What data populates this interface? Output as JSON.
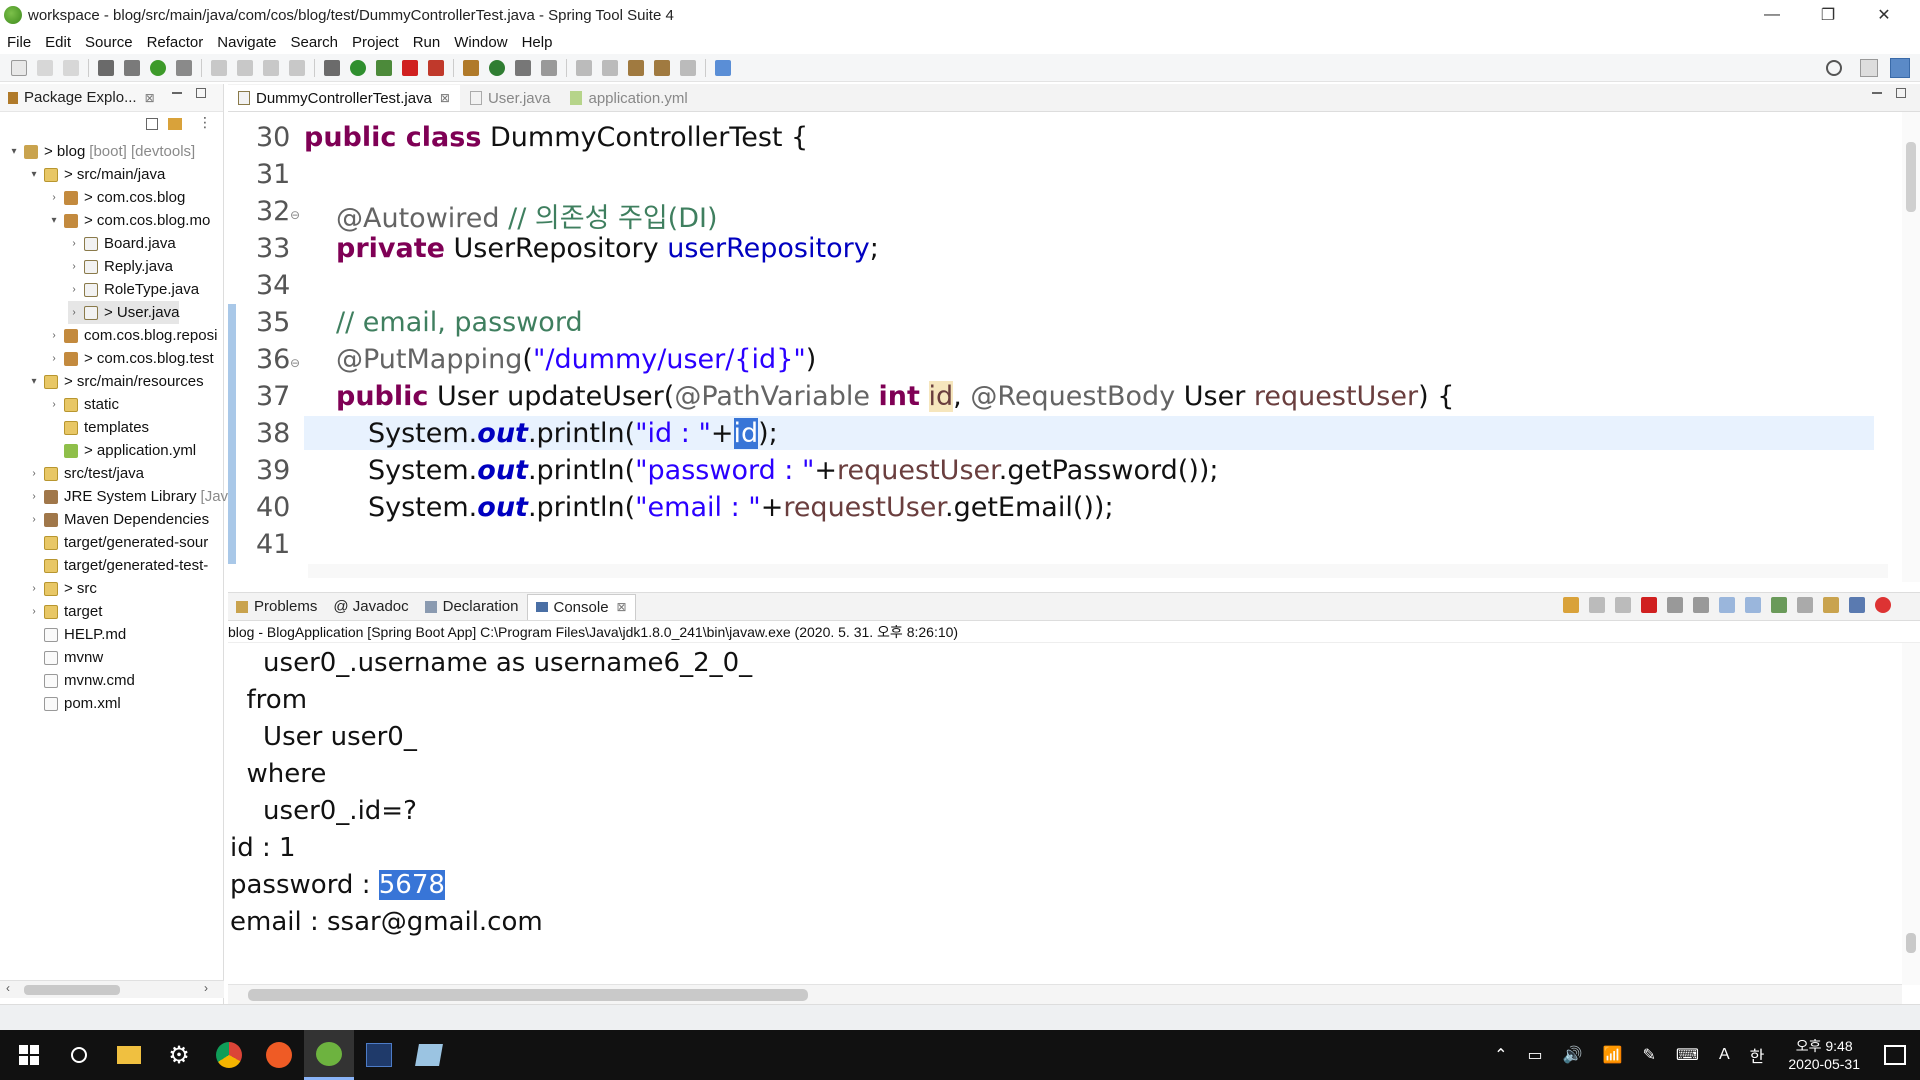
{
  "window": {
    "title": "workspace - blog/src/main/java/com/cos/blog/test/DummyControllerTest.java - Spring Tool Suite 4",
    "minimize": "—",
    "maximize": "❐",
    "close": "✕"
  },
  "menu": [
    "File",
    "Edit",
    "Source",
    "Refactor",
    "Navigate",
    "Search",
    "Project",
    "Run",
    "Window",
    "Help"
  ],
  "explorer": {
    "title": "Package Explo...",
    "close": "⊠",
    "items": [
      {
        "arrow": "▾",
        "icon": "project",
        "label": "> blog",
        "extra": "[boot] [devtools]"
      },
      {
        "arrow": "▾",
        "icon": "folder",
        "label": "> src/main/java"
      },
      {
        "arrow": "›",
        "icon": "pkg",
        "label": "> com.cos.blog"
      },
      {
        "arrow": "▾",
        "icon": "pkg",
        "label": "> com.cos.blog.mo"
      },
      {
        "arrow": "›",
        "icon": "java",
        "label": "Board.java"
      },
      {
        "arrow": "›",
        "icon": "java",
        "label": "Reply.java"
      },
      {
        "arrow": "›",
        "icon": "java",
        "label": "RoleType.java"
      },
      {
        "arrow": "›",
        "icon": "java",
        "label": "> User.java"
      },
      {
        "arrow": "›",
        "icon": "pkg",
        "label": "com.cos.blog.reposi"
      },
      {
        "arrow": "›",
        "icon": "pkg",
        "label": "> com.cos.blog.test"
      },
      {
        "arrow": "▾",
        "icon": "folder",
        "label": "> src/main/resources"
      },
      {
        "arrow": "›",
        "icon": "folder",
        "label": "static"
      },
      {
        "arrow": "",
        "icon": "folder",
        "label": "templates"
      },
      {
        "arrow": "",
        "icon": "yml",
        "label": "> application.yml"
      },
      {
        "arrow": "›",
        "icon": "folder",
        "label": "src/test/java"
      },
      {
        "arrow": "›",
        "icon": "lib",
        "label": "JRE System Library",
        "extra": "[Jav"
      },
      {
        "arrow": "›",
        "icon": "lib",
        "label": "Maven Dependencies"
      },
      {
        "arrow": "",
        "icon": "folder",
        "label": "target/generated-sour"
      },
      {
        "arrow": "",
        "icon": "folder",
        "label": "target/generated-test-"
      },
      {
        "arrow": "›",
        "icon": "folder",
        "label": "> src"
      },
      {
        "arrow": "›",
        "icon": "folder",
        "label": "target"
      },
      {
        "arrow": "",
        "icon": "file",
        "label": "HELP.md"
      },
      {
        "arrow": "",
        "icon": "file",
        "label": "mvnw"
      },
      {
        "arrow": "",
        "icon": "file",
        "label": "mvnw.cmd"
      },
      {
        "arrow": "",
        "icon": "file",
        "label": "pom.xml"
      }
    ]
  },
  "editor": {
    "tabs": [
      {
        "label": "DummyControllerTest.java",
        "close": "⊠",
        "active": true
      },
      {
        "label": "User.java",
        "close": "",
        "active": false
      },
      {
        "label": "application.yml",
        "close": "",
        "active": false
      }
    ],
    "line_numbers": [
      "30",
      "31",
      "32",
      "33",
      "34",
      "35",
      "36",
      "37",
      "38",
      "39",
      "40",
      "41"
    ],
    "code": {
      "l30_kw": "public class",
      "l30_rest": " DummyControllerTest {",
      "l32_ann": "@Autowired",
      "l32_cm": " // 의존성 주입(DI)",
      "l33_kw": "private",
      "l33_type": " UserRepository ",
      "l33_field": "userRepository",
      "l33_end": ";",
      "l35_cm": "// email, password",
      "l36_ann": "@PutMapping",
      "l36_open": "(",
      "l36_str": "\"/dummy/user/{id}\"",
      "l36_close": ")",
      "l37_kw1": "public",
      "l37_a": " User updateUser(",
      "l37_ann1": "@PathVariable",
      "l37_sp": " ",
      "l37_kw2": "int",
      "l37_sp2": " ",
      "l37_id": "id",
      "l37_b": ", ",
      "l37_ann2": "@RequestBody",
      "l37_c": " User ",
      "l37_var": "requestUser",
      "l37_d": ") {",
      "l38_a": "System.",
      "l38_out": "out",
      "l38_b": ".println(",
      "l38_str": "\"id : \"",
      "l38_plus": "+",
      "l38_sel": "id",
      "l38_end": ");",
      "l39_a": "System.",
      "l39_out": "out",
      "l39_b": ".println(",
      "l39_str": "\"password : \"",
      "l39_plus": "+",
      "l39_var": "requestUser",
      "l39_end": ".getPassword());",
      "l40_a": "System.",
      "l40_out": "out",
      "l40_b": ".println(",
      "l40_str": "\"email : \"",
      "l40_plus": "+",
      "l40_var": "requestUser",
      "l40_end": ".getEmail());"
    }
  },
  "console": {
    "tabs": [
      "Problems",
      "@ Javadoc",
      "Declaration",
      "Console"
    ],
    "description": "blog - BlogApplication [Spring Boot App] C:\\Program Files\\Java\\jdk1.8.0_241\\bin\\javaw.exe  (2020. 5. 31. 오후 8:26:10)",
    "lines": [
      "    user0_.username as username6_2_0_",
      "  from",
      "    User user0_",
      "  where",
      "    user0_.id=?",
      "id : 1"
    ],
    "password_label": "password : ",
    "password_value": "5678",
    "email_line": "email : ssar@gmail.com"
  },
  "taskbar": {
    "time": "오후 9:48",
    "date": "2020-05-31",
    "ime_a": "A",
    "ime_han": "한"
  },
  "colors": {
    "keyword": "#7f0055",
    "string": "#2a00ff",
    "comment": "#3f7f5f",
    "field": "#0000c0",
    "selection": "#3875d7"
  }
}
